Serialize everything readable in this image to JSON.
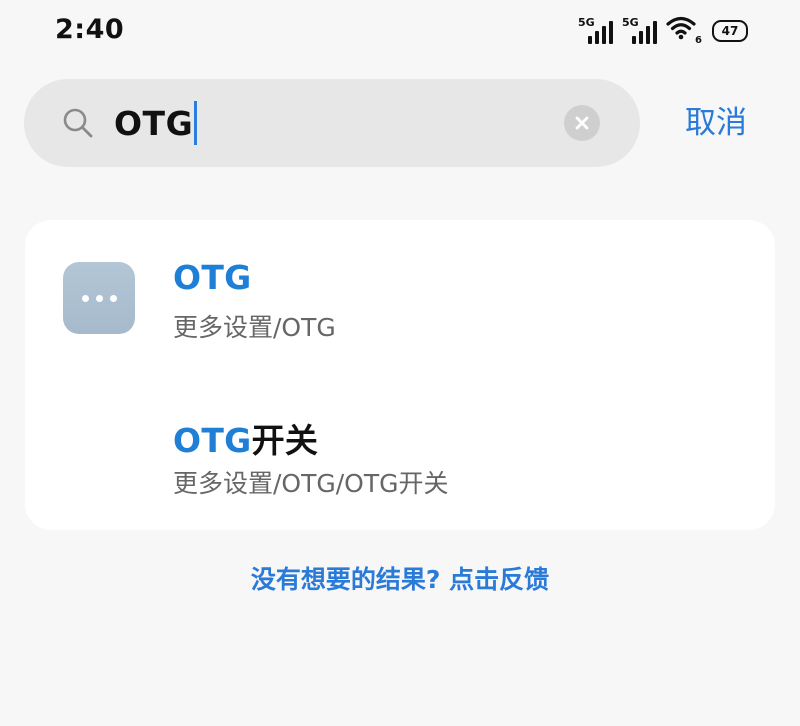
{
  "status_bar": {
    "time": "2:40",
    "network_1": "5G",
    "network_2": "5G",
    "wifi_level": "6",
    "battery": "47"
  },
  "search": {
    "query": "OTG",
    "cancel_label": "取消"
  },
  "results": [
    {
      "title_highlight": "OTG",
      "title_rest": "",
      "path": "更多设置/OTG",
      "icon": "more-settings-icon"
    },
    {
      "title_highlight": "OTG",
      "title_rest": "开关",
      "path": "更多设置/OTG/OTG开关",
      "icon": ""
    }
  ],
  "feedback": {
    "label": "没有想要的结果? 点击反馈"
  },
  "colors": {
    "accent": "#2a7ad8",
    "highlight": "#1f7fd6",
    "search_bg": "#e7e7e7",
    "page_bg": "#f7f7f7"
  }
}
